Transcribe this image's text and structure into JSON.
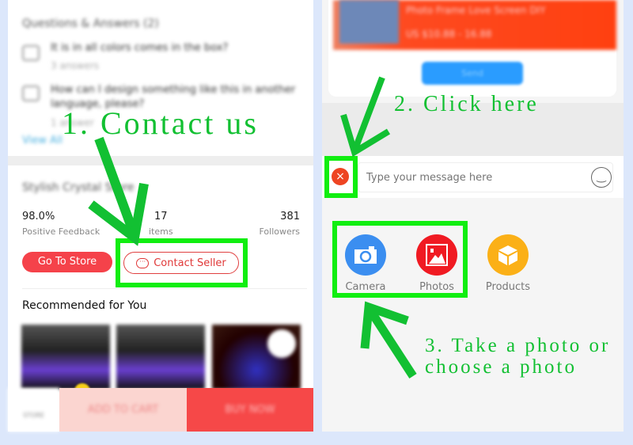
{
  "left": {
    "qa_title": "Questions & Answers (2)",
    "qa_items": [
      {
        "question": "It is in all colors comes in the box?",
        "answers": "3 answers"
      },
      {
        "question": "How can I design something like this in another language, please?",
        "answers": "1 answer"
      }
    ],
    "view_all": "View All",
    "store_name": "Stylish Crystal Store",
    "stats": [
      {
        "value": "98.0%",
        "label": "Positive Feedback"
      },
      {
        "value": "17",
        "label": "items"
      },
      {
        "value": "381",
        "label": "Followers"
      }
    ],
    "go_to_store": "Go To Store",
    "contact_seller": "Contact Seller",
    "recommended": "Recommended for You",
    "bottom": {
      "store": "STORE",
      "add_to_cart": "ADD TO CART",
      "buy_now": "BUY NOW"
    }
  },
  "right": {
    "product_title": "Photo Frame Love Screen DIY",
    "product_price": "US $10.88 - 16.88",
    "send": "Send",
    "message_placeholder": "Type your message here",
    "attachments": [
      {
        "label": "Camera",
        "icon": "camera-icon",
        "color": "#3b8ef0"
      },
      {
        "label": "Photos",
        "icon": "photo-icon",
        "color": "#f01a22"
      },
      {
        "label": "Products",
        "icon": "box-icon",
        "color": "#fbb017"
      }
    ]
  },
  "annotations": {
    "step1": "1. Contact us",
    "step2": "2. Click here",
    "step3_line1": "3. Take a photo or",
    "step3_line2": "choose a photo"
  },
  "colors": {
    "annotation": "#12c032",
    "highlight": "#10ee10",
    "accent_red": "#f5424a"
  }
}
